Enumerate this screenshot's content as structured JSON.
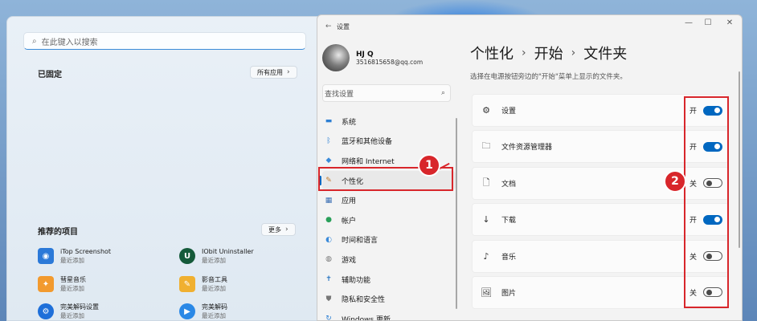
{
  "start_menu": {
    "search_placeholder": "在此键入以搜索",
    "pinned_title": "已固定",
    "all_apps_label": "所有应用",
    "recommended_title": "推荐的项目",
    "more_label": "更多",
    "recommended": [
      {
        "name": "iTop Screenshot",
        "sub": "最近添加",
        "icon": "itop-screenshot-icon",
        "color": "#2b79d8"
      },
      {
        "name": "IObit Uninstaller",
        "sub": "最近添加",
        "icon": "iobit-uninstaller-icon",
        "color": "#155a3a"
      },
      {
        "name": "彗星音乐",
        "sub": "最近添加",
        "icon": "comet-music-icon",
        "color": "#f29a2e"
      },
      {
        "name": "影音工具",
        "sub": "最近添加",
        "icon": "media-tools-icon",
        "color": "#f0b030"
      },
      {
        "name": "完美解码设置",
        "sub": "最近添加",
        "icon": "perfect-decoder-settings-icon",
        "color": "#1e6fd9"
      },
      {
        "name": "完美解码",
        "sub": "最近添加",
        "icon": "perfect-decoder-icon",
        "color": "#2a88e6"
      }
    ]
  },
  "settings": {
    "window_title": "设置",
    "user_name": "HJ Q",
    "user_email": "3516815658@qq.com",
    "search_placeholder": "查找设置",
    "nav": [
      {
        "label": "系统",
        "icon": "system-icon",
        "color": "#2d7fd3"
      },
      {
        "label": "蓝牙和其他设备",
        "icon": "bluetooth-icon",
        "color": "#2d7fd3"
      },
      {
        "label": "网络和 Internet",
        "icon": "network-icon",
        "color": "#3a8ad9"
      },
      {
        "label": "个性化",
        "icon": "personalization-icon",
        "color": "#c07a2b"
      },
      {
        "label": "应用",
        "icon": "apps-icon",
        "color": "#3b6fb3"
      },
      {
        "label": "帐户",
        "icon": "accounts-icon",
        "color": "#2aa05a"
      },
      {
        "label": "时间和语言",
        "icon": "time-language-icon",
        "color": "#3a8ad9"
      },
      {
        "label": "游戏",
        "icon": "gaming-icon",
        "color": "#777777"
      },
      {
        "label": "辅助功能",
        "icon": "accessibility-icon",
        "color": "#1f6fbf"
      },
      {
        "label": "隐私和安全性",
        "icon": "privacy-icon",
        "color": "#777777"
      },
      {
        "label": "Windows 更新",
        "icon": "windows-update-icon",
        "color": "#2d7fd3"
      }
    ],
    "breadcrumb": [
      "个性化",
      "开始",
      "文件夹"
    ],
    "description": "选择在电源按钮旁边的\"开始\"菜单上显示的文件夹。",
    "folders": [
      {
        "label": "设置",
        "icon": "gear-icon",
        "state": "开",
        "on": true
      },
      {
        "label": "文件资源管理器",
        "icon": "folder-icon",
        "state": "开",
        "on": true
      },
      {
        "label": "文档",
        "icon": "document-icon",
        "state": "关",
        "on": false
      },
      {
        "label": "下载",
        "icon": "download-icon",
        "state": "开",
        "on": true
      },
      {
        "label": "音乐",
        "icon": "music-icon",
        "state": "关",
        "on": false
      },
      {
        "label": "图片",
        "icon": "picture-icon",
        "state": "关",
        "on": false
      }
    ]
  },
  "annotations": {
    "badge1": "1",
    "badge2": "2",
    "color": "#d8262b"
  }
}
